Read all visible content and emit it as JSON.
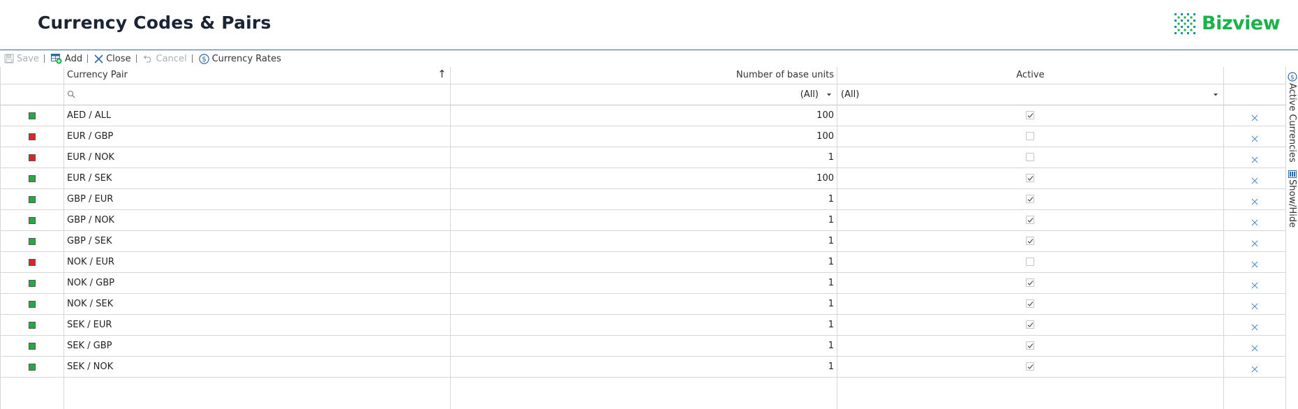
{
  "header": {
    "title": "Currency Codes & Pairs",
    "brand": "Bizview",
    "brand_color": "#19b34a"
  },
  "toolbar": {
    "save_label": "Save",
    "add_label": "Add",
    "close_label": "Close",
    "cancel_label": "Cancel",
    "currency_rates_label": "Currency Rates"
  },
  "grid": {
    "columns": {
      "currency_pair": "Currency Pair",
      "base_units": "Number of base units",
      "active": "Active"
    },
    "sort_indicator": "↑",
    "filters": {
      "base_units": "(All)",
      "active": "(All)"
    },
    "rows": [
      {
        "pair": "AED / ALL",
        "units": "100",
        "active": true
      },
      {
        "pair": "EUR / GBP",
        "units": "100",
        "active": false
      },
      {
        "pair": "EUR / NOK",
        "units": "1",
        "active": false
      },
      {
        "pair": "EUR / SEK",
        "units": "100",
        "active": true
      },
      {
        "pair": "GBP / EUR",
        "units": "1",
        "active": true
      },
      {
        "pair": "GBP / NOK",
        "units": "1",
        "active": true
      },
      {
        "pair": "GBP / SEK",
        "units": "1",
        "active": true
      },
      {
        "pair": "NOK / EUR",
        "units": "1",
        "active": false
      },
      {
        "pair": "NOK / GBP",
        "units": "1",
        "active": true
      },
      {
        "pair": "NOK / SEK",
        "units": "1",
        "active": true
      },
      {
        "pair": "SEK / EUR",
        "units": "1",
        "active": true
      },
      {
        "pair": "SEK / GBP",
        "units": "1",
        "active": true
      },
      {
        "pair": "SEK / NOK",
        "units": "1",
        "active": true
      }
    ]
  },
  "side_panel": {
    "active_currencies_label": "Active Currencies",
    "show_hide_label": "Show/Hide"
  },
  "colors": {
    "active_status": "#27a844",
    "inactive_status": "#d62828",
    "accent": "#2d6aa3"
  }
}
